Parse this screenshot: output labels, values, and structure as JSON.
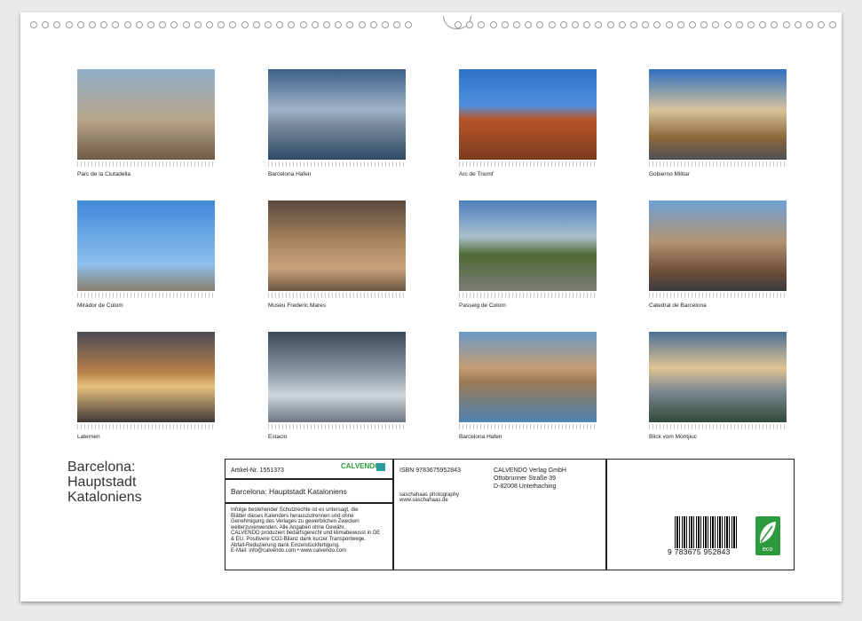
{
  "calendar_title": [
    "Barcelona:",
    "Hauptstadt",
    "Kataloniens"
  ],
  "photos": [
    {
      "caption": "Parc de la Ciutadella"
    },
    {
      "caption": "Barcelona Hafen"
    },
    {
      "caption": "Arc de Triomf"
    },
    {
      "caption": "Gobierno Militar"
    },
    {
      "caption": "Mirador de Colom"
    },
    {
      "caption": "Museu Frederic Mares"
    },
    {
      "caption": "Passeig de Colom"
    },
    {
      "caption": "Catedral de Barcelona"
    },
    {
      "caption": "Laternen"
    },
    {
      "caption": "Estacio"
    },
    {
      "caption": "Barcelona Hafen"
    },
    {
      "caption": "Blick vom Montjiuc"
    }
  ],
  "info": {
    "article": "Artikel-Nr. 1551373",
    "brand": "CALVENDO",
    "title": "Barcelona: Hauptstadt Kataloniens",
    "legal": [
      "Infolge bestehender Schutzrechte ist es untersagt, die",
      "Blätter dieses Kalenders herauszutrennen und ohne",
      "Genehmigung des Verlages zu gewerblichen Zwecken",
      "weiterzuverwenden. Alle Angaben ohne Gewähr.",
      "CALVENDO produziert bedarfsgerecht und klimabewusst in DE",
      "& EU. Positivere CO2-Bilanz dank kurzer Transportwege.",
      "Abfall-Reduzierung dank Einzelstückfertigung.",
      "E-Mail: info@calvendo.com • www.calvendo.com"
    ],
    "isbn": "ISBN 9783675952843",
    "photographer": "saschahaas photography",
    "website": "www.saschahaas.de",
    "publisher": [
      "CALVENDO Verlag GmbH",
      "Ottobrunner Straße 39",
      "D-82008 Unterhaching"
    ],
    "barcode_number": "9  783675  952843",
    "eco_label": "eco"
  },
  "colors": {
    "accent": "#2e9a3e",
    "border": "#222222"
  }
}
